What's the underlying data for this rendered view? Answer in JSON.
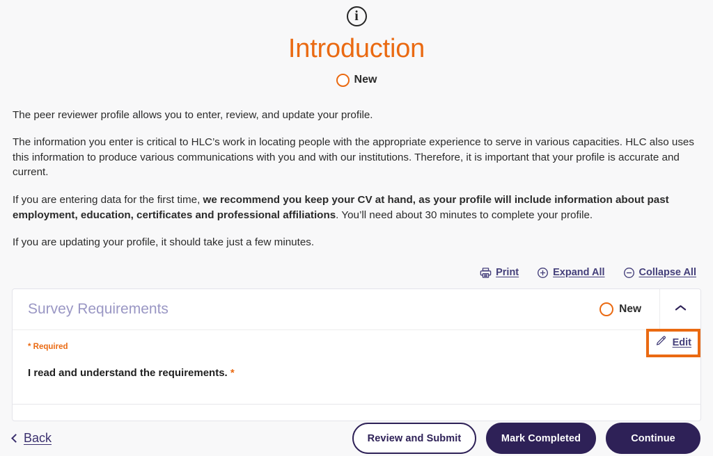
{
  "header": {
    "icon": "info-circle-icon",
    "title": "Introduction",
    "status": {
      "icon": "status-circle-icon",
      "label": "New"
    }
  },
  "body": {
    "paragraphs": [
      {
        "id": "p1",
        "runs": [
          {
            "text": "The peer reviewer profile allows you to enter, review, and update your profile.",
            "bold": false
          }
        ]
      },
      {
        "id": "p2",
        "runs": [
          {
            "text": "The information you enter is critical to HLC’s work in locating people with the appropriate experience to serve in various capacities.  HLC also uses this information to produce various communications with you and with our institutions.  Therefore, it is important that your profile is accurate and current.",
            "bold": false
          }
        ]
      },
      {
        "id": "p3",
        "runs": [
          {
            "text": "If you are entering data for the first time, ",
            "bold": false
          },
          {
            "text": "we recommend you keep your CV at hand, as your profile will include information about past employment, education, certificates and professional affiliations",
            "bold": true
          },
          {
            "text": ". You’ll need about 30 minutes to complete your profile.",
            "bold": false
          }
        ]
      },
      {
        "id": "p4",
        "runs": [
          {
            "text": "If you are updating your profile, it should take just a few minutes.",
            "bold": false
          }
        ]
      }
    ]
  },
  "toolbar": {
    "print_label": "Print",
    "print_icon": "printer-icon",
    "expand_all_label": "Expand All",
    "expand_all_icon": "plus-circle-icon",
    "collapse_all_label": "Collapse All",
    "collapse_all_icon": "minus-circle-icon"
  },
  "card": {
    "title": "Survey Requirements",
    "status": {
      "icon": "status-circle-icon",
      "label": "New"
    },
    "toggle_icon": "chevron-up-icon",
    "required_note": "* Required",
    "question": "I read and understand the requirements.",
    "question_star": "*",
    "edit_label": "Edit",
    "edit_icon": "pencil-icon"
  },
  "footer": {
    "back_label": "Back",
    "back_icon": "chevron-left-icon",
    "review_and_submit_label": "Review and Submit",
    "mark_completed_label": "Mark Completed",
    "continue_label": "Continue"
  },
  "colors": {
    "accent_orange": "#ea6a12",
    "brand_navy": "#2e2157",
    "link_purple": "#443f7a",
    "card_title_lavender": "#9a97c4",
    "page_background": "#f8f8f9"
  }
}
